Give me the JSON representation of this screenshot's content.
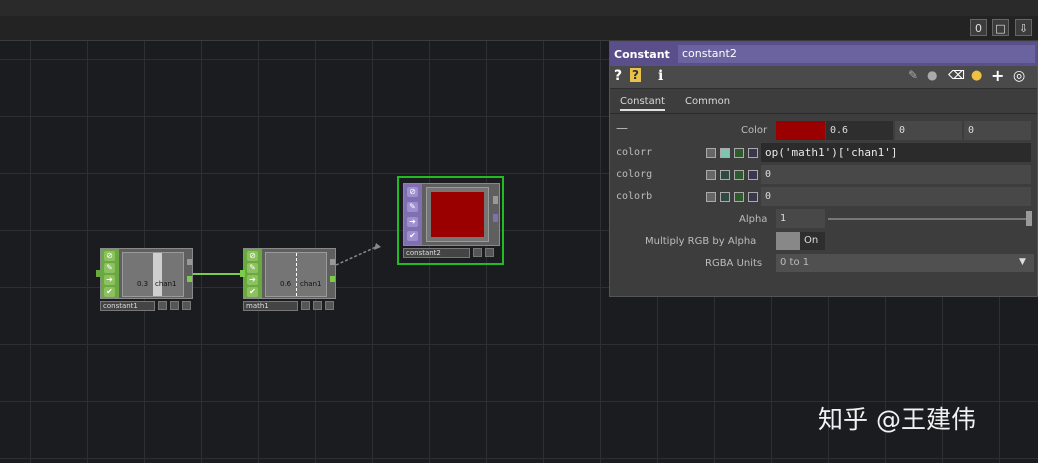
{
  "toolbar": {
    "btn1": "0",
    "btn2": "□",
    "btn3": "⇩"
  },
  "nodes": {
    "constant1": {
      "name": "constant1",
      "value": "0.3",
      "channel": "chan1"
    },
    "math1": {
      "name": "math1",
      "value": "0.6",
      "channel": "chan1"
    },
    "constant2": {
      "name": "constant2"
    }
  },
  "panel": {
    "type": "Constant",
    "name": "constant2",
    "tabs": [
      "Constant",
      "Common"
    ],
    "color_label": "Color",
    "color_values": [
      "0.6",
      "0",
      "0"
    ],
    "colorr_label": "colorr",
    "colorr_expr": "op('math1')['chan1']",
    "colorg_label": "colorg",
    "colorg_value": "0",
    "colorb_label": "colorb",
    "colorb_value": "0",
    "alpha_label": "Alpha",
    "alpha_value": "1",
    "multiply_label": "Multiply RGB by Alpha",
    "multiply_value": "On",
    "units_label": "RGBA Units",
    "units_value": "0 to 1"
  },
  "colors": {
    "swatch": "#9b0000",
    "title_bar": "#5a4f8a",
    "chop_green": "#6aa940",
    "top_purple": "#8070b0"
  },
  "watermark": "知乎 @王建伟"
}
